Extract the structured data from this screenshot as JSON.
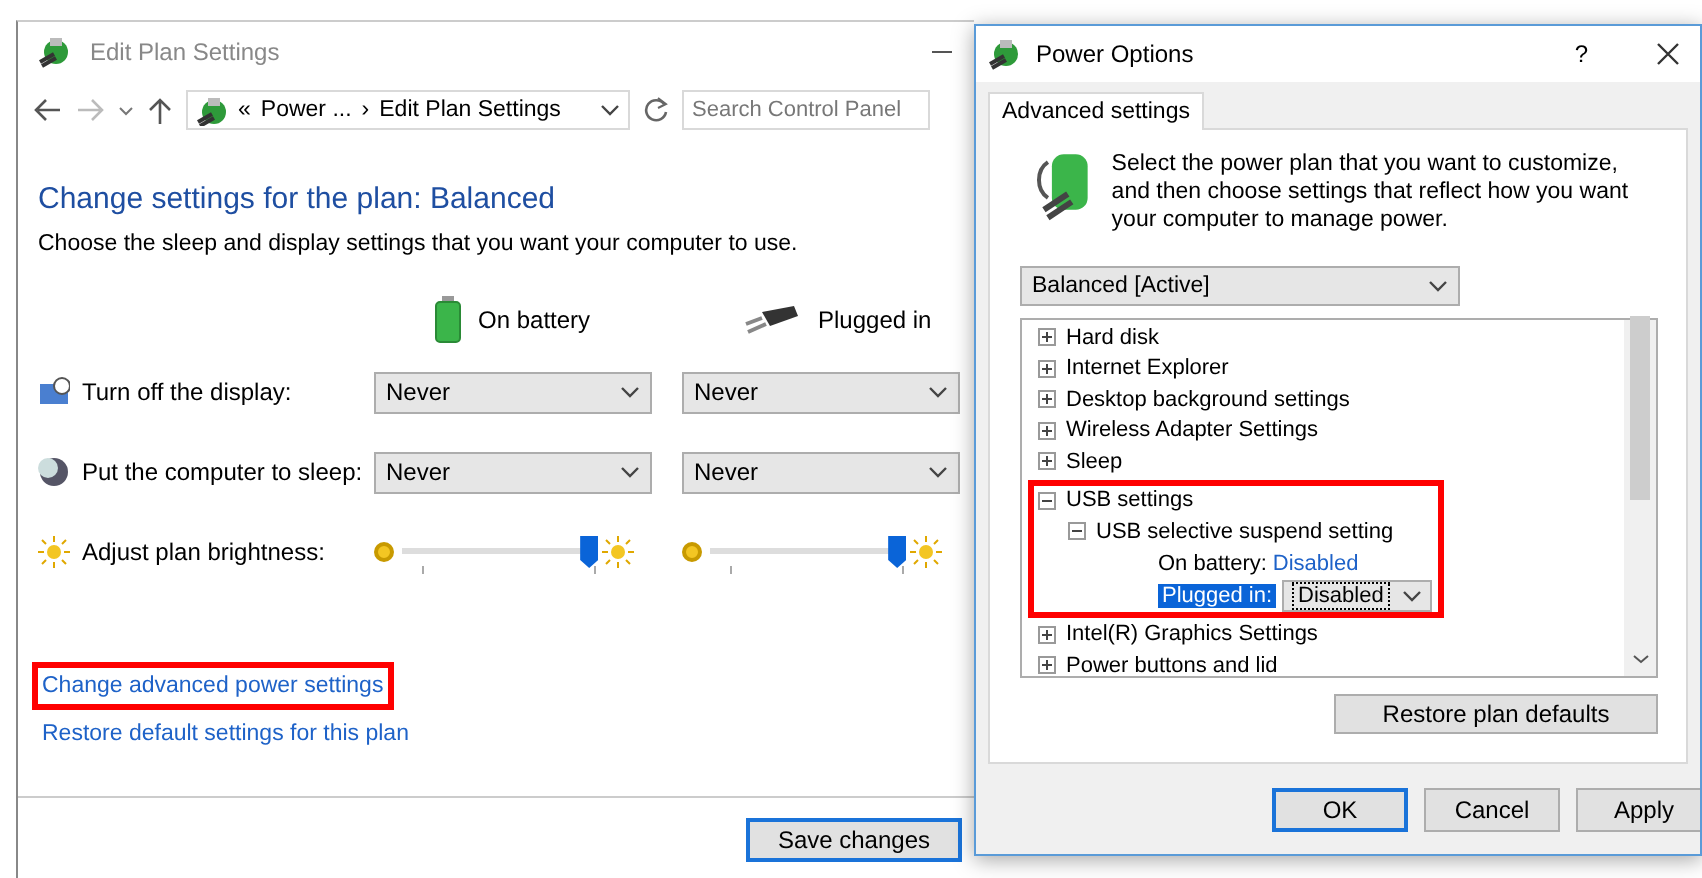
{
  "edit_plan": {
    "title": "Edit Plan Settings",
    "address": {
      "prefix": "«",
      "items": [
        "Power ...",
        "Edit Plan Settings"
      ],
      "separator": "›"
    },
    "search": {
      "placeholder": "Search Control Panel"
    },
    "heading": "Change settings for the plan: Balanced",
    "description": "Choose the sleep and display settings that you want your computer to use.",
    "columns": [
      {
        "kind": "battery",
        "label": "On battery"
      },
      {
        "kind": "plug",
        "label": "Plugged in"
      }
    ],
    "settings": [
      {
        "kind": "dropdown",
        "label": "Turn off the display:",
        "values": [
          "Never",
          "Never"
        ]
      },
      {
        "kind": "dropdown",
        "label": "Put the computer to sleep:",
        "values": [
          "Never",
          "Never"
        ]
      },
      {
        "kind": "slider",
        "label": "Adjust plan brightness:",
        "sliders": [
          {
            "level": 0.98
          },
          {
            "level": 0.98
          }
        ]
      }
    ],
    "links": [
      {
        "text": "Change advanced power settings",
        "highlighted": true
      },
      {
        "text": "Restore default settings for this plan",
        "highlighted": false
      }
    ],
    "save_button": "Save changes"
  },
  "power_options": {
    "title": "Power Options",
    "help": "?",
    "tabs": [
      {
        "label": "Advanced settings",
        "selected": true
      }
    ],
    "intro": "Select the power plan that you want to customize, and then choose settings that reflect how you want your computer to manage power.",
    "plan": "Balanced [Active]",
    "tree": [
      {
        "label": "Hard disk",
        "expanded": false,
        "highlighted": false
      },
      {
        "label": "Internet Explorer",
        "expanded": false,
        "highlighted": false
      },
      {
        "label": "Desktop background settings",
        "expanded": false,
        "highlighted": false
      },
      {
        "label": "Wireless Adapter Settings",
        "expanded": false,
        "highlighted": false
      },
      {
        "label": "Sleep",
        "expanded": false,
        "highlighted": false
      },
      {
        "label": "USB settings",
        "expanded": true,
        "highlighted": true,
        "children": [
          {
            "label": "USB selective suspend setting",
            "expanded": true,
            "highlighted": false,
            "options": [
              {
                "kind": "value",
                "label": "On battery:",
                "value": "Disabled",
                "selected": false
              },
              {
                "kind": "dropdown",
                "label": "Plugged in:",
                "value": "Disabled",
                "selected": true
              }
            ]
          }
        ]
      },
      {
        "label": "Intel(R) Graphics Settings",
        "expanded": false,
        "highlighted": false
      },
      {
        "label": "Power buttons and lid",
        "expanded": false,
        "highlighted": false
      }
    ],
    "restore_button": "Restore plan defaults",
    "buttons": [
      {
        "label": "OK",
        "default": true
      },
      {
        "label": "Cancel",
        "default": false
      },
      {
        "label": "Apply",
        "default": false
      }
    ]
  }
}
